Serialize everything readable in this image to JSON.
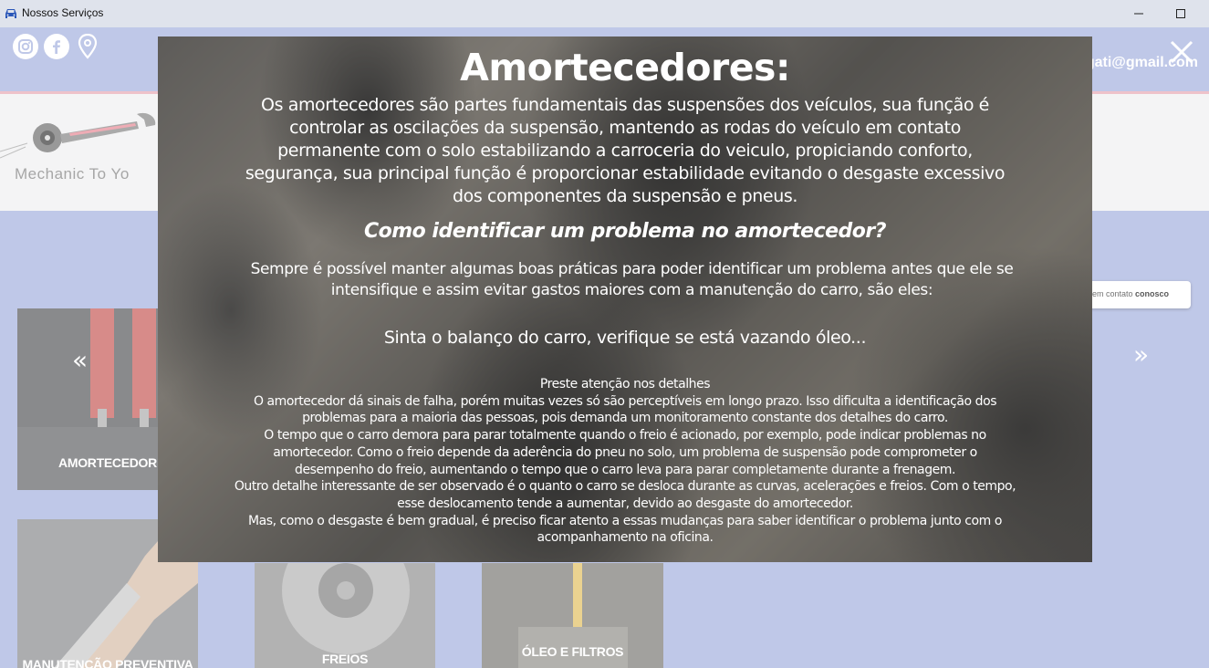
{
  "window": {
    "title": "Nossos Serviços",
    "minimize_glyph": "—",
    "maximize_glyph": "☐"
  },
  "topbar": {
    "email": "gati@gmail.com",
    "social": [
      "instagram-icon",
      "facebook-icon",
      "location-pin-icon"
    ]
  },
  "header": {
    "logo_text": "Mechanic To Yo"
  },
  "cards": [
    {
      "label": "AMORTECEDOR"
    },
    {
      "label": "MANUTENÇÃO PREVENTIVA"
    },
    {
      "label": "FREIOS"
    },
    {
      "label": "ÓLEO E FILTROS"
    }
  ],
  "carousel": {
    "prev": "«",
    "next": "»"
  },
  "whatsapp": {
    "text_prefix": "Entre em contato ",
    "text_bold": "conosco"
  },
  "modal": {
    "title": "Amortecedores:",
    "intro": "Os amortecedores são partes fundamentais das suspensões dos veículos, sua função é controlar as oscilações da suspensão, mantendo as rodas do veículo em contato permanente com o solo estabilizando a carroceria do veiculo, propiciando conforto, segurança, sua principal função é proporcionar estabilidade evitando o desgaste excessivo dos componentes da suspensão e pneus.",
    "subtitle": "Como identificar um problema no amortecedor?",
    "practices": "Sempre é possível manter algumas boas práticas para poder identificar um problema antes que ele se intensifique e assim evitar gastos maiores com a manutenção do carro, são eles:",
    "tip": "Sinta o balanço do carro, verifique se está vazando óleo...",
    "details": [
      "Preste atenção nos detalhes",
      "O amortecedor dá sinais de falha, porém muitas vezes só são perceptíveis em longo prazo. Isso dificulta a identificação dos problemas para a maioria das pessoas, pois demanda um monitoramento constante dos detalhes do carro.",
      "O tempo que o carro demora para parar totalmente quando o freio é acionado, por exemplo, pode indicar problemas no amortecedor. Como o freio depende da aderência do pneu no solo, um problema de suspensão pode comprometer o desempenho do freio, aumentando o tempo que o carro leva para parar completamente durante a frenagem.",
      "Outro detalhe interessante de ser observado é o quanto o carro se desloca durante as curvas, acelerações e freios. Com o tempo, esse deslocamento tende a aumentar, devido ao desgaste do amortecedor.",
      "Mas, como o desgaste é bem gradual, é preciso ficar atento a essas mudanças para saber identificar o problema junto com o acompanhamento na oficina."
    ]
  },
  "colors": {
    "page_bg": "#aab6e0",
    "accent_line": "#e8aeb9",
    "whatsapp": "#3fc253"
  }
}
